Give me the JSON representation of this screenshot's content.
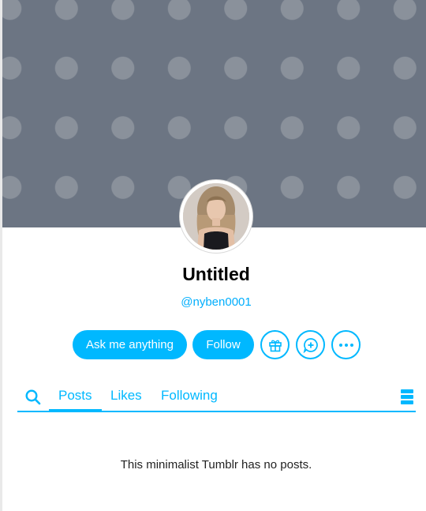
{
  "blog": {
    "title": "Untitled",
    "handle": "@nyben0001"
  },
  "actions": {
    "ask_label": "Ask me anything",
    "follow_label": "Follow",
    "icons": [
      "gift-icon",
      "chat-plus-icon",
      "more-icon"
    ]
  },
  "tabs": {
    "search_icon": "search-icon",
    "items": [
      {
        "label": "Posts",
        "active": true
      },
      {
        "label": "Likes",
        "active": false
      },
      {
        "label": "Following",
        "active": false
      }
    ],
    "layout_icon": "layout-toggle-icon"
  },
  "content": {
    "empty_message": "This minimalist Tumblr has no posts."
  },
  "colors": {
    "accent": "#00b8ff",
    "handle": "#00aefd",
    "header_background": "#6c7583",
    "header_dots": "#8a919b"
  }
}
